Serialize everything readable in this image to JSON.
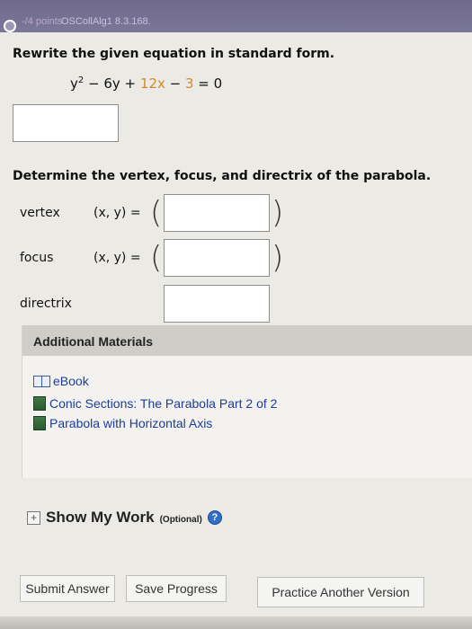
{
  "header": {
    "points": "-/4 points",
    "problem_code": "OSCollAlg1 8.3.168."
  },
  "question1": {
    "prompt": "Rewrite the given equation in standard form.",
    "equation": {
      "y_term": "y",
      "y_exp": "2",
      "minus1": " − 6y + ",
      "x_term": "12x",
      "minus2": " − ",
      "const_term": "3",
      "equals": " = 0"
    }
  },
  "question2": {
    "prompt": "Determine the vertex, focus, and directrix of the parabola.",
    "vertex": {
      "label": "vertex",
      "pair": "(x, y) ="
    },
    "focus": {
      "label": "focus",
      "pair": "(x, y) ="
    },
    "directrix": {
      "label": "directrix"
    }
  },
  "materials": {
    "title": "Additional Materials",
    "items": [
      {
        "label": "eBook",
        "icon": "book-icon"
      },
      {
        "label": "Conic Sections: The Parabola Part 2 of 2",
        "icon": "video-icon"
      },
      {
        "label": "Parabola with Horizontal Axis",
        "icon": "video-icon"
      }
    ]
  },
  "show_work": {
    "label": "Show My Work",
    "optional": "(Optional)",
    "help": "?"
  },
  "buttons": {
    "submit": "Submit Answer",
    "save": "Save Progress",
    "practice": "Practice Another Version"
  },
  "colors": {
    "highlight": "#d4892b",
    "link": "#1c3d99",
    "header_bar": "#74708f"
  }
}
